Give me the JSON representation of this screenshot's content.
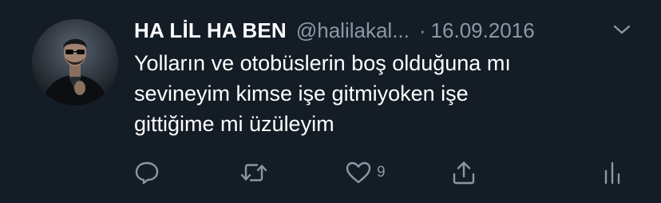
{
  "tweet": {
    "display_name": "HA LİL HA BEN",
    "handle": "@halilakal...",
    "separator": "·",
    "date": "16.09.2016",
    "text_lines": [
      "Yolların ve otobüslerin boş olduğuna mı",
      "sevineyim kimse işe gitmiyoken işe",
      "gittiğime mi üzüleyim"
    ],
    "actions": {
      "like_count": "9"
    }
  },
  "colors": {
    "background": "#141d26",
    "primary_text": "#ffffff",
    "secondary_text": "#8899a6"
  },
  "icons": [
    "avatar-photo",
    "chevron-down-icon",
    "reply-icon",
    "retweet-icon",
    "like-icon",
    "share-icon",
    "analytics-icon"
  ]
}
